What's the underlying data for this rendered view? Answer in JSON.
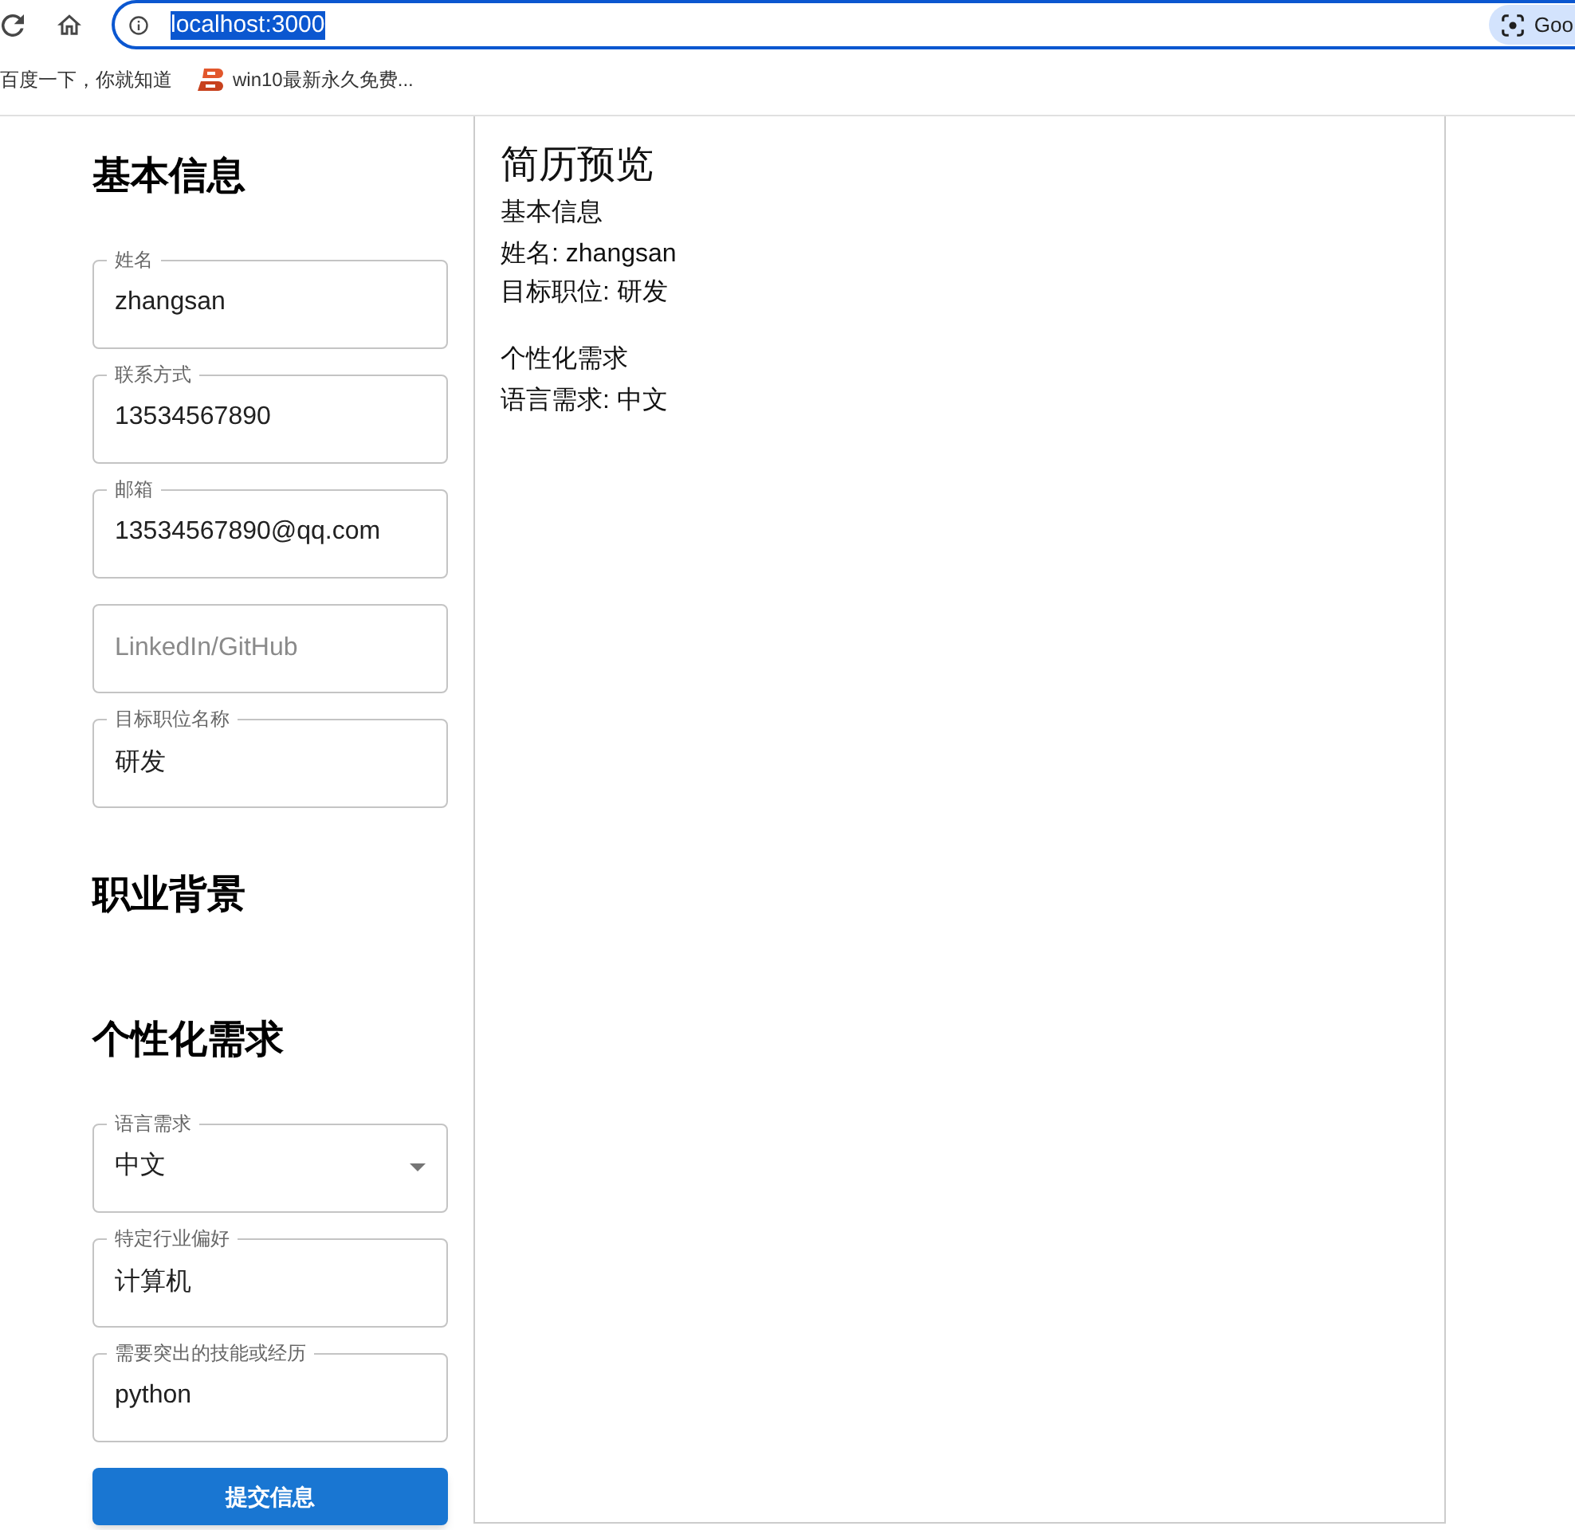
{
  "browser": {
    "address_bar": {
      "url": "localhost:3000",
      "url_selected": true,
      "lens_chip": "Goo"
    },
    "bookmarks": [
      {
        "kind": "text",
        "label": "百度一下，你就知道"
      },
      {
        "kind": "favicon",
        "label": "win10最新永久免费..."
      }
    ]
  },
  "form": {
    "sections": [
      {
        "title": "基本信息",
        "fields": [
          {
            "kind": "text",
            "label": "姓名",
            "value": "zhangsan"
          },
          {
            "kind": "text",
            "label": "联系方式",
            "value": "13534567890"
          },
          {
            "kind": "text",
            "label": "邮箱",
            "value": "13534567890@qq.com"
          },
          {
            "kind": "text",
            "placeholder": "LinkedIn/GitHub"
          },
          {
            "kind": "text",
            "label": "目标职位名称",
            "value": "研发"
          }
        ]
      },
      {
        "title": "职业背景"
      },
      {
        "title": "个性化需求",
        "fields": [
          {
            "kind": "select",
            "label": "语言需求",
            "value": "中文"
          },
          {
            "kind": "text",
            "label": "特定行业偏好",
            "value": "计算机"
          },
          {
            "kind": "text",
            "label": "需要突出的技能或经历",
            "value": "python"
          }
        ]
      }
    ],
    "submit_button": "提交信息"
  },
  "preview": {
    "title": "简历预览",
    "sections": [
      {
        "title": "基本信息",
        "lines": [
          "姓名: zhangsan",
          "目标职位: 研发"
        ]
      },
      {
        "title": "个性化需求",
        "lines": [
          "语言需求: 中文"
        ]
      }
    ]
  }
}
